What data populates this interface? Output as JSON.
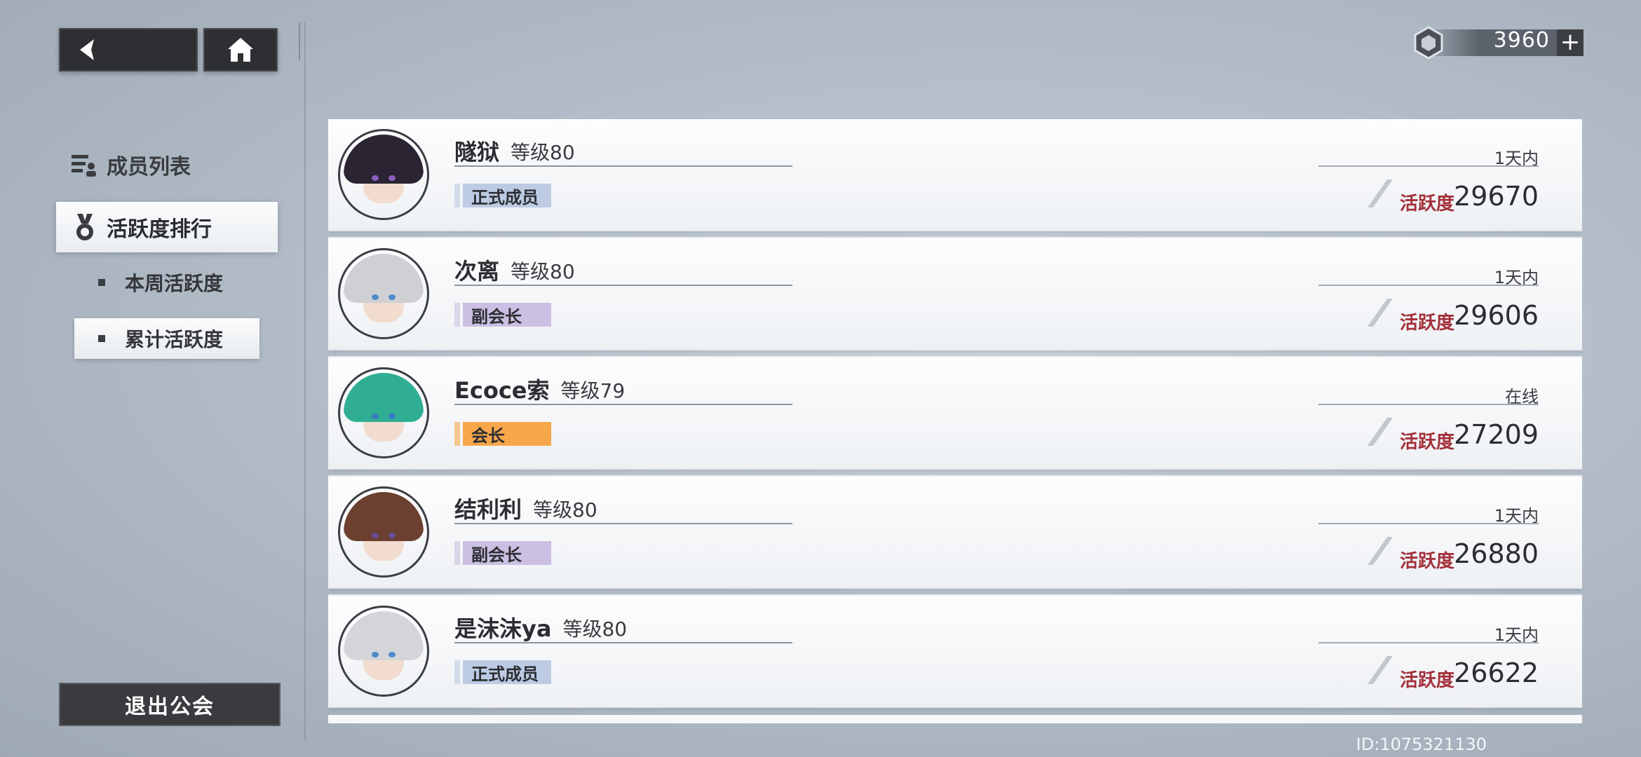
{
  "currency": {
    "value": "3960",
    "plus_label": "+",
    "icon": "guild-coin-icon"
  },
  "nav": {
    "back_icon": "back-arrow-icon",
    "home_icon": "home-icon"
  },
  "menu": {
    "header": "成员列表",
    "selected": "活跃度排行",
    "sub_items": [
      "本周活跃度",
      "累计活跃度"
    ],
    "quit_label": "退出公会"
  },
  "activity_label": "活跃度",
  "members": [
    {
      "name": "隧狱",
      "level": "等级80",
      "role": "正式成员",
      "role_color": "#bccbe3",
      "status": "1天内",
      "activity": "29670",
      "hair": "#2a2433",
      "eye": "#8a5fc2"
    },
    {
      "name": "次离",
      "level": "等级80",
      "role": "副会长",
      "role_color": "#cbbfe3",
      "status": "1天内",
      "activity": "29606",
      "hair": "#cfd0d4",
      "eye": "#4d8cc9"
    },
    {
      "name": "Ecoce索",
      "level": "等级79",
      "role": "会长",
      "role_color": "#f7a64a",
      "status": "在线",
      "activity": "27209",
      "hair": "#2fae94",
      "eye": "#3a78c2"
    },
    {
      "name": "结利利",
      "level": "等级80",
      "role": "副会长",
      "role_color": "#cbbfe3",
      "status": "1天内",
      "activity": "26880",
      "hair": "#6b4030",
      "eye": "#6a4a9a"
    },
    {
      "name": "是沫沫ya",
      "level": "等级80",
      "role": "正式成员",
      "role_color": "#bccbe3",
      "status": "1天内",
      "activity": "26622",
      "hair": "#d4d5d9",
      "eye": "#4d8cc9"
    }
  ],
  "player_id": "ID:1075321130"
}
